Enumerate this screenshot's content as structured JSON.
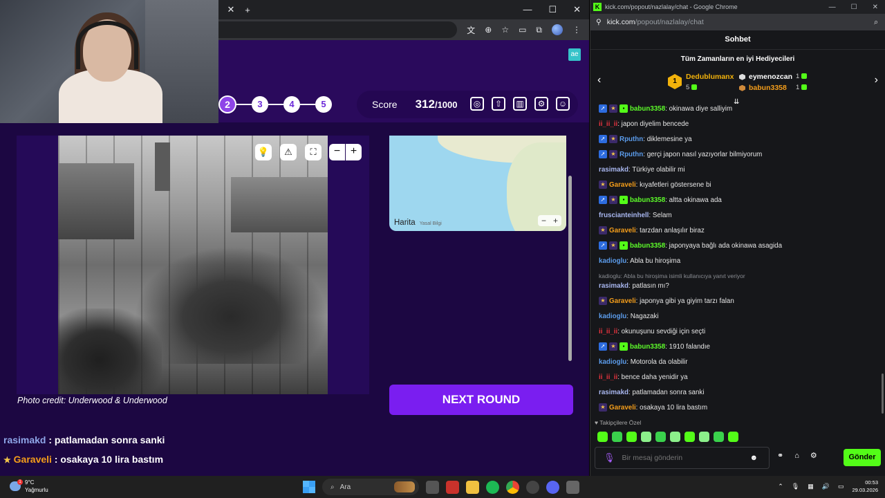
{
  "game": {
    "ae_badge": "ae",
    "rounds": [
      "2",
      "3",
      "4",
      "5"
    ],
    "score_label": "Score",
    "score_value": "312",
    "score_max": "/1000",
    "photo_credit": "Photo credit: Underwood & Underwood",
    "map_brand": "Harita",
    "map_legal": "Yasal Bilgi",
    "next_round": "NEXT ROUND",
    "overlay": [
      {
        "user": "rasimakd",
        "text": " : patlamadan sonra sanki"
      },
      {
        "user": "Garaveli",
        "text": " : osakaya 10 lira bastım"
      }
    ]
  },
  "chat_window": {
    "title": "kick.com/popout/nazlalay/chat - Google Chrome",
    "url_host": "kick.com",
    "url_path": "/popout/nazlalay/chat",
    "header": "Sohbet",
    "gifters_title": "Tüm Zamanların en iyi Hediyecileri",
    "gifters": [
      {
        "rank": "1",
        "name": "Dedublumanx",
        "count": "5"
      },
      {
        "name": "eymenozcan",
        "count": "1"
      },
      {
        "name": "babun3358",
        "count": "1"
      }
    ],
    "messages": [
      {
        "badges": "agf",
        "user": "babun3358",
        "color": "c-green",
        "text": ": okinawa diye salliyim"
      },
      {
        "badges": "",
        "user": "ii_ii_ii",
        "color": "c-red",
        "text": ": japon diyelim bencede"
      },
      {
        "badges": "as",
        "user": "Rputhn",
        "color": "c-blue",
        "text": ": diklemesine ya"
      },
      {
        "badges": "as",
        "user": "Rputhn",
        "color": "c-blue",
        "text": ": gerçi japon nasıl yazıyorlar bilmiyorum"
      },
      {
        "badges": "",
        "user": "rasimakd",
        "color": "c-lav",
        "text": ": Türkiye olabilir mi"
      },
      {
        "badges": "s",
        "user": "Garaveli",
        "color": "c-orange",
        "text": ": kıyafetleri göstersene bi"
      },
      {
        "badges": "agf",
        "user": "babun3358",
        "color": "c-green",
        "text": ": altta okinawa ada"
      },
      {
        "badges": "",
        "user": "fruscianteinhell",
        "color": "c-lav",
        "text": ": Selam"
      },
      {
        "badges": "s",
        "user": "Garaveli",
        "color": "c-orange",
        "text": ": tarzdan anlaşılır biraz"
      },
      {
        "badges": "agf",
        "user": "babun3358",
        "color": "c-green",
        "text": ": japonyaya bağlı ada okinawa asagida"
      },
      {
        "badges": "",
        "user": "kadioglu",
        "color": "c-blue",
        "text": ": Abla bu hiroşima"
      },
      {
        "reply": "kadioglu: Abla bu hiroşima isimli kullanıcıya yanıt veriyor",
        "badges": "",
        "user": "rasimakd",
        "color": "c-lav",
        "text": ": patlasın mı?"
      },
      {
        "badges": "s",
        "user": "Garaveli",
        "color": "c-orange",
        "text": ": japonya gibi ya giyim tarzı falan"
      },
      {
        "badges": "",
        "user": "kadioglu",
        "color": "c-blue",
        "text": ": Nagazaki"
      },
      {
        "badges": "",
        "user": "ii_ii_ii",
        "color": "c-red",
        "text": ": okunuşunu sevdiği için seçti"
      },
      {
        "badges": "agf",
        "user": "babun3358",
        "color": "c-green",
        "text": ": 1910 falandıe"
      },
      {
        "badges": "",
        "user": "kadioglu",
        "color": "c-blue",
        "text": ": Motorola da olabilir"
      },
      {
        "badges": "",
        "user": "ii_ii_ii",
        "color": "c-red",
        "text": ": bence daha yenidir ya"
      },
      {
        "badges": "",
        "user": "rasimakd",
        "color": "c-lav",
        "text": ": patlamadan sonra sanki"
      },
      {
        "badges": "s",
        "user": "Garaveli",
        "color": "c-orange",
        "text": ": osakaya 10 lira bastım"
      }
    ],
    "emote_section": "Takipçilere Özel",
    "input_placeholder": "Bir mesaj gönderin",
    "send_label": "Gönder"
  },
  "taskbar": {
    "temp": "9°C",
    "weather": "Yağmurlu",
    "search": "Ara",
    "time": "00:53",
    "date": "29.03.2026"
  }
}
